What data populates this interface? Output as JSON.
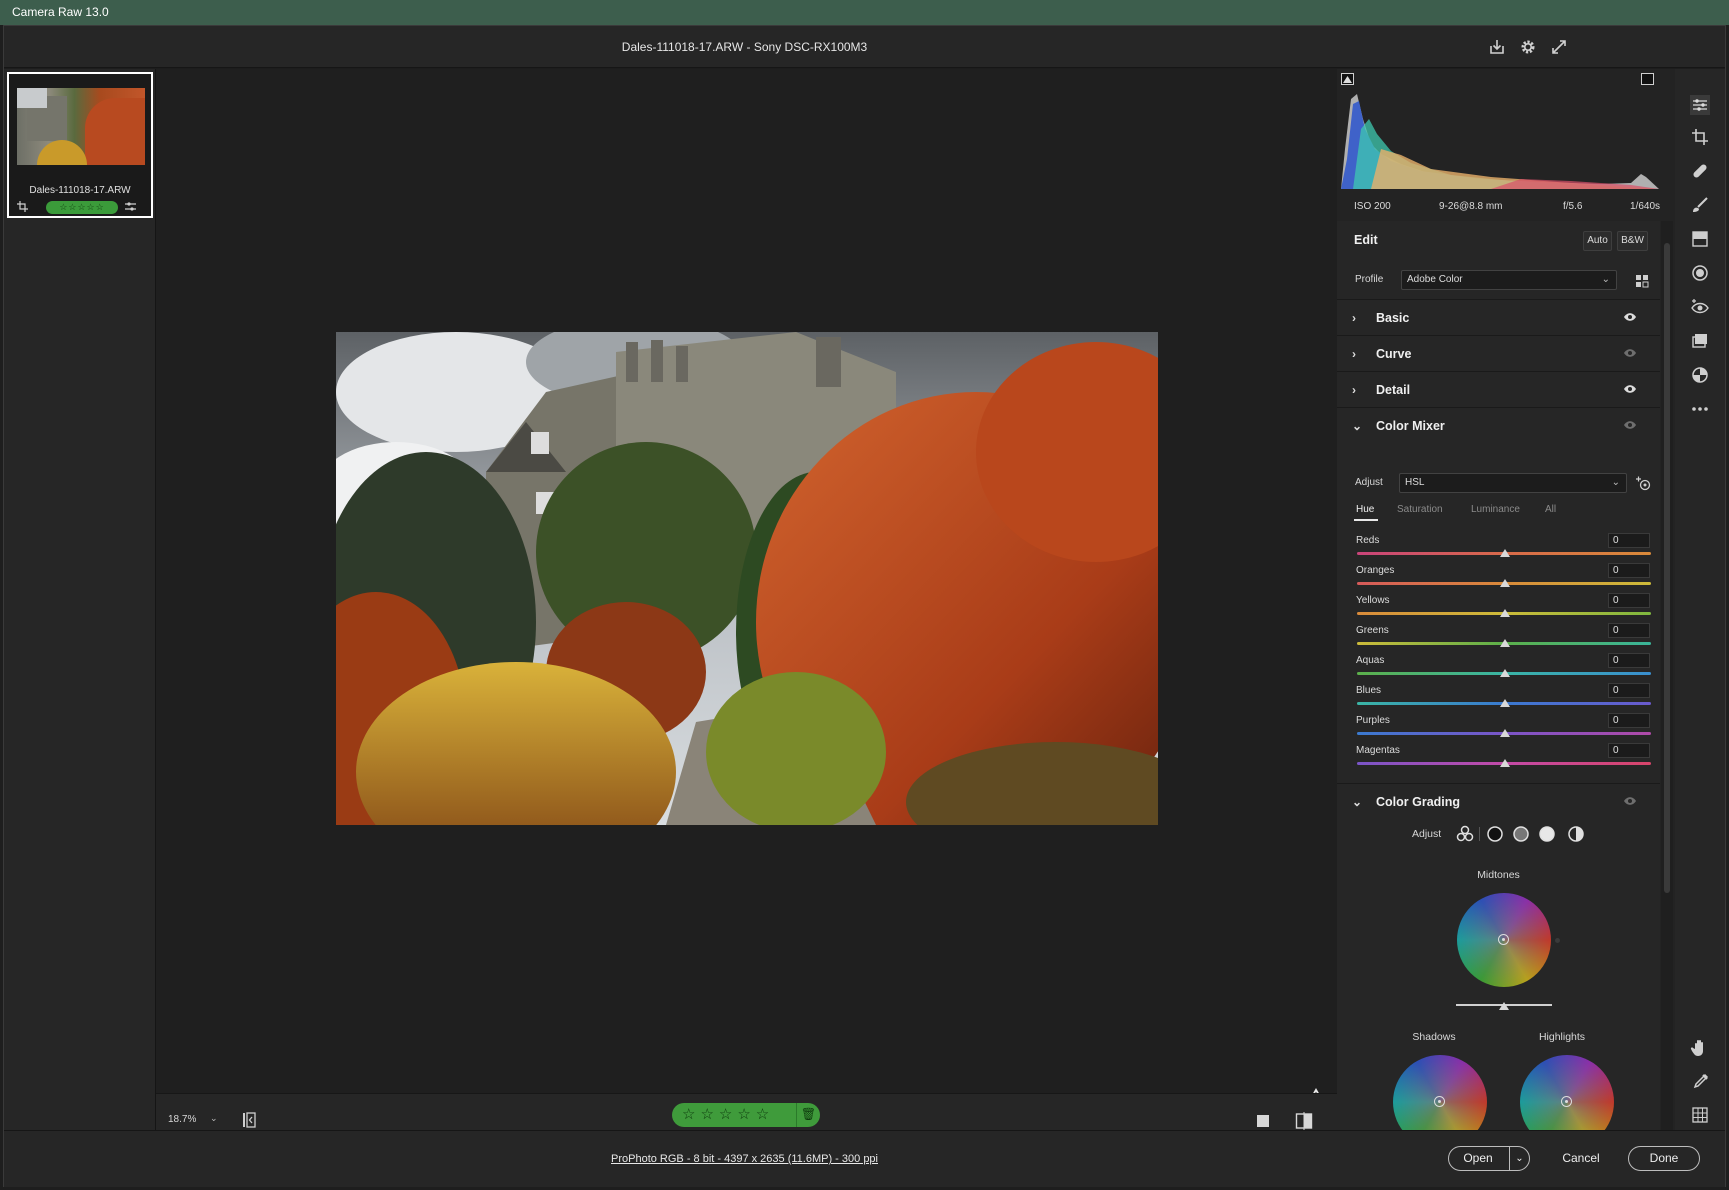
{
  "window": {
    "title": "Camera Raw 13.0"
  },
  "header": {
    "document_title": "Dales-111018-17.ARW  -  Sony DSC-RX100M3"
  },
  "filmstrip": {
    "items": [
      {
        "name": "Dales-111018-17.ARW",
        "rating_stars": "☆☆☆☆☆"
      }
    ]
  },
  "canvas": {
    "zoom": "18.7%",
    "rating_stars": "☆☆☆☆☆"
  },
  "histogram": {
    "clipping_shadow": "shadow-clipping-warning",
    "clipping_highlight": "highlight-clipping-warning"
  },
  "exif": {
    "iso": "ISO 200",
    "lens": "9-26@8.8 mm",
    "aperture": "f/5.6",
    "shutter": "1/640s"
  },
  "edit": {
    "title": "Edit",
    "auto_label": "Auto",
    "bw_label": "B&W",
    "profile_label": "Profile",
    "profile_value": "Adobe Color",
    "sections": {
      "basic": "Basic",
      "curve": "Curve",
      "detail": "Detail",
      "color_mixer": "Color Mixer",
      "color_grading": "Color Grading"
    },
    "color_mixer": {
      "adjust_label": "Adjust",
      "adjust_value": "HSL",
      "tabs": [
        "Hue",
        "Saturation",
        "Luminance",
        "All"
      ],
      "active_tab": "Hue",
      "sliders": [
        {
          "name": "Reds",
          "value": "0"
        },
        {
          "name": "Oranges",
          "value": "0"
        },
        {
          "name": "Yellows",
          "value": "0"
        },
        {
          "name": "Greens",
          "value": "0"
        },
        {
          "name": "Aquas",
          "value": "0"
        },
        {
          "name": "Blues",
          "value": "0"
        },
        {
          "name": "Purples",
          "value": "0"
        },
        {
          "name": "Magentas",
          "value": "0"
        }
      ]
    },
    "color_grading": {
      "adjust_label": "Adjust",
      "midtones": "Midtones",
      "shadows": "Shadows",
      "highlights": "Highlights"
    }
  },
  "status": {
    "info": "ProPhoto RGB - 8 bit - 4397 x 2635 (11.6MP) - 300 ppi"
  },
  "buttons": {
    "open": "Open",
    "cancel": "Cancel",
    "done": "Done"
  },
  "colors": {
    "accent_green": "#3f9b3b",
    "titlebar": "#3d5e4d"
  }
}
